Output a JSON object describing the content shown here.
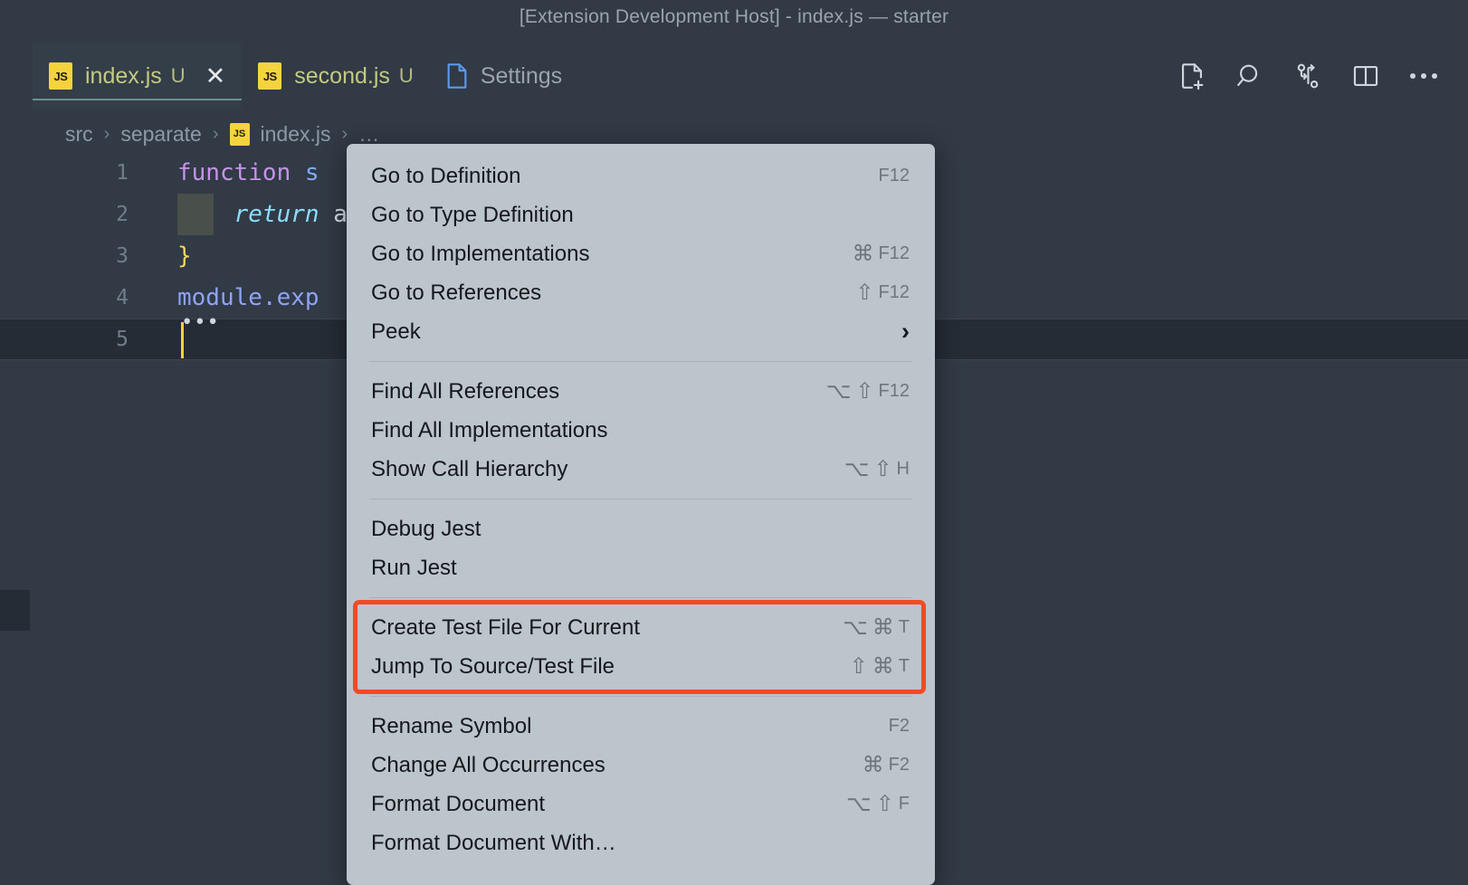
{
  "window": {
    "title": "[Extension Development Host] - index.js — starter"
  },
  "tabs": [
    {
      "label": "index.js",
      "icon": "js-file-icon",
      "status": "U",
      "active": true,
      "closable": true,
      "close_label": "✕"
    },
    {
      "label": "second.js",
      "icon": "js-file-icon",
      "status": "U",
      "active": false,
      "closable": false
    },
    {
      "label": "Settings",
      "icon": "settings-file-icon",
      "status": "",
      "active": false,
      "closable": false
    }
  ],
  "tab_actions": [
    {
      "name": "new-file-icon"
    },
    {
      "name": "search-icon"
    },
    {
      "name": "source-control-icon"
    },
    {
      "name": "split-editor-icon"
    },
    {
      "name": "more-actions-icon"
    }
  ],
  "breadcrumb": {
    "items": [
      "src",
      "separate",
      "index.js",
      "…"
    ],
    "separator": "›",
    "file_icon_label": "JS"
  },
  "editor": {
    "line_numbers": [
      "1",
      "2",
      "3",
      "4",
      "5"
    ],
    "lines": [
      {
        "tokens": [
          {
            "t": "function ",
            "c": "kw"
          },
          {
            "t": "s",
            "c": "fname"
          }
        ]
      },
      {
        "tokens": [
          {
            "t": "    ",
            "c": "plain"
          },
          {
            "t": "return ",
            "c": "ret"
          },
          {
            "t": "a",
            "c": "plain"
          }
        ]
      },
      {
        "tokens": [
          {
            "t": "}",
            "c": "brace"
          }
        ]
      },
      {
        "tokens": [
          {
            "t": "module.exp",
            "c": "modexp"
          }
        ]
      },
      {
        "tokens": [
          {
            "t": "",
            "c": "plain"
          }
        ]
      }
    ],
    "fold_marker": "•••",
    "current_line": 5
  },
  "context_menu": {
    "groups": [
      {
        "items": [
          {
            "label": "Go to Definition",
            "keys": [
              {
                "type": "text",
                "v": "F12"
              }
            ]
          },
          {
            "label": "Go to Type Definition",
            "keys": []
          },
          {
            "label": "Go to Implementations",
            "keys": [
              {
                "type": "glyph",
                "v": "⌘"
              },
              {
                "type": "text",
                "v": "F12"
              }
            ]
          },
          {
            "label": "Go to References",
            "keys": [
              {
                "type": "glyph",
                "v": "⇧"
              },
              {
                "type": "text",
                "v": "F12"
              }
            ]
          },
          {
            "label": "Peek",
            "submenu": true,
            "chevron": "›",
            "keys": []
          }
        ]
      },
      {
        "items": [
          {
            "label": "Find All References",
            "keys": [
              {
                "type": "glyph",
                "v": "⌥"
              },
              {
                "type": "glyph",
                "v": "⇧"
              },
              {
                "type": "text",
                "v": "F12"
              }
            ]
          },
          {
            "label": "Find All Implementations",
            "keys": []
          },
          {
            "label": "Show Call Hierarchy",
            "keys": [
              {
                "type": "glyph",
                "v": "⌥"
              },
              {
                "type": "glyph",
                "v": "⇧"
              },
              {
                "type": "text",
                "v": "H"
              }
            ]
          }
        ]
      },
      {
        "items": [
          {
            "label": "Debug Jest",
            "keys": []
          },
          {
            "label": "Run Jest",
            "keys": []
          }
        ]
      },
      {
        "highlighted": true,
        "items": [
          {
            "label": "Create Test File For Current",
            "keys": [
              {
                "type": "glyph",
                "v": "⌥"
              },
              {
                "type": "glyph",
                "v": "⌘"
              },
              {
                "type": "text",
                "v": "T"
              }
            ]
          },
          {
            "label": "Jump To Source/Test File",
            "keys": [
              {
                "type": "glyph",
                "v": "⇧"
              },
              {
                "type": "glyph",
                "v": "⌘"
              },
              {
                "type": "text",
                "v": "T"
              }
            ]
          }
        ]
      },
      {
        "items": [
          {
            "label": "Rename Symbol",
            "keys": [
              {
                "type": "text",
                "v": "F2"
              }
            ]
          },
          {
            "label": "Change All Occurrences",
            "keys": [
              {
                "type": "glyph",
                "v": "⌘"
              },
              {
                "type": "text",
                "v": "F2"
              }
            ]
          },
          {
            "label": "Format Document",
            "keys": [
              {
                "type": "glyph",
                "v": "⌥"
              },
              {
                "type": "glyph",
                "v": "⇧"
              },
              {
                "type": "text",
                "v": "F"
              }
            ]
          },
          {
            "label": "Format Document With…",
            "keys": []
          }
        ]
      }
    ]
  },
  "colors": {
    "menu_bg": "#bcc4cc",
    "highlight_border": "#f24a28",
    "editor_bg": "#313a45",
    "js_badge": "#f5d33f",
    "modified_tab_text": "#c4cb80"
  }
}
